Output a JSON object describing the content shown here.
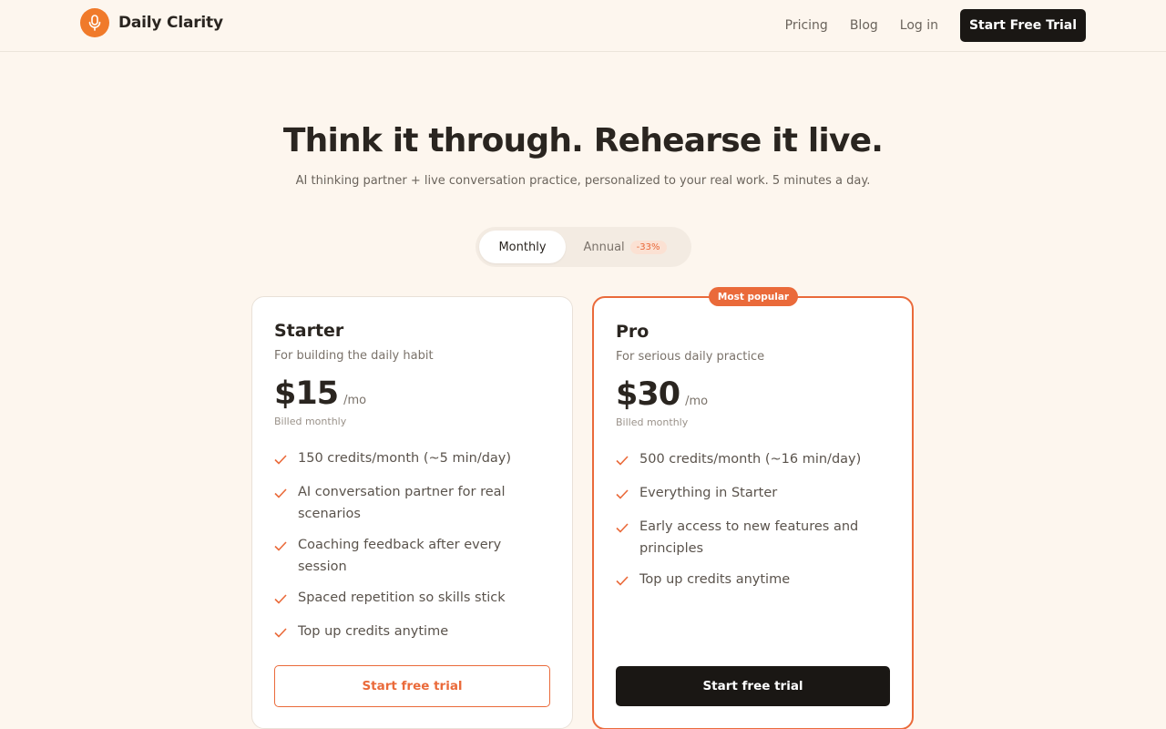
{
  "brand": {
    "name": "Daily Clarity",
    "logo_icon": "microphone-icon",
    "accent": "#f07a2a"
  },
  "nav": {
    "pricing": "Pricing",
    "blog": "Blog",
    "login": "Log in",
    "cta": "Start Free Trial"
  },
  "hero": {
    "title": "Think it through. Rehearse it live.",
    "subtitle": "AI thinking partner + live conversation practice, personalized to your real work. 5 minutes a day."
  },
  "billing_toggle": {
    "monthly": "Monthly",
    "annual": "Annual",
    "annual_badge": "-33%",
    "selected": "Monthly"
  },
  "plans": [
    {
      "name": "Starter",
      "description": "For building the daily habit",
      "price": "$15",
      "period": "/mo",
      "billed": "Billed monthly",
      "features": [
        "150 credits/month (~5 min/day)",
        "AI conversation partner for real scenarios",
        "Coaching feedback after every session",
        "Spaced repetition so skills stick",
        "Top up credits anytime"
      ],
      "cta": "Start free trial"
    },
    {
      "name": "Pro",
      "badge": "Most popular",
      "description": "For serious daily practice",
      "price": "$30",
      "period": "/mo",
      "billed": "Billed monthly",
      "features": [
        "500 credits/month (~16 min/day)",
        "Everything in Starter",
        "Early access to new features and principles",
        "Top up credits anytime"
      ],
      "cta": "Start free trial"
    }
  ],
  "colors": {
    "accent": "#ea6a3a",
    "dark": "#1a1714",
    "background": "#fdf6ee"
  }
}
